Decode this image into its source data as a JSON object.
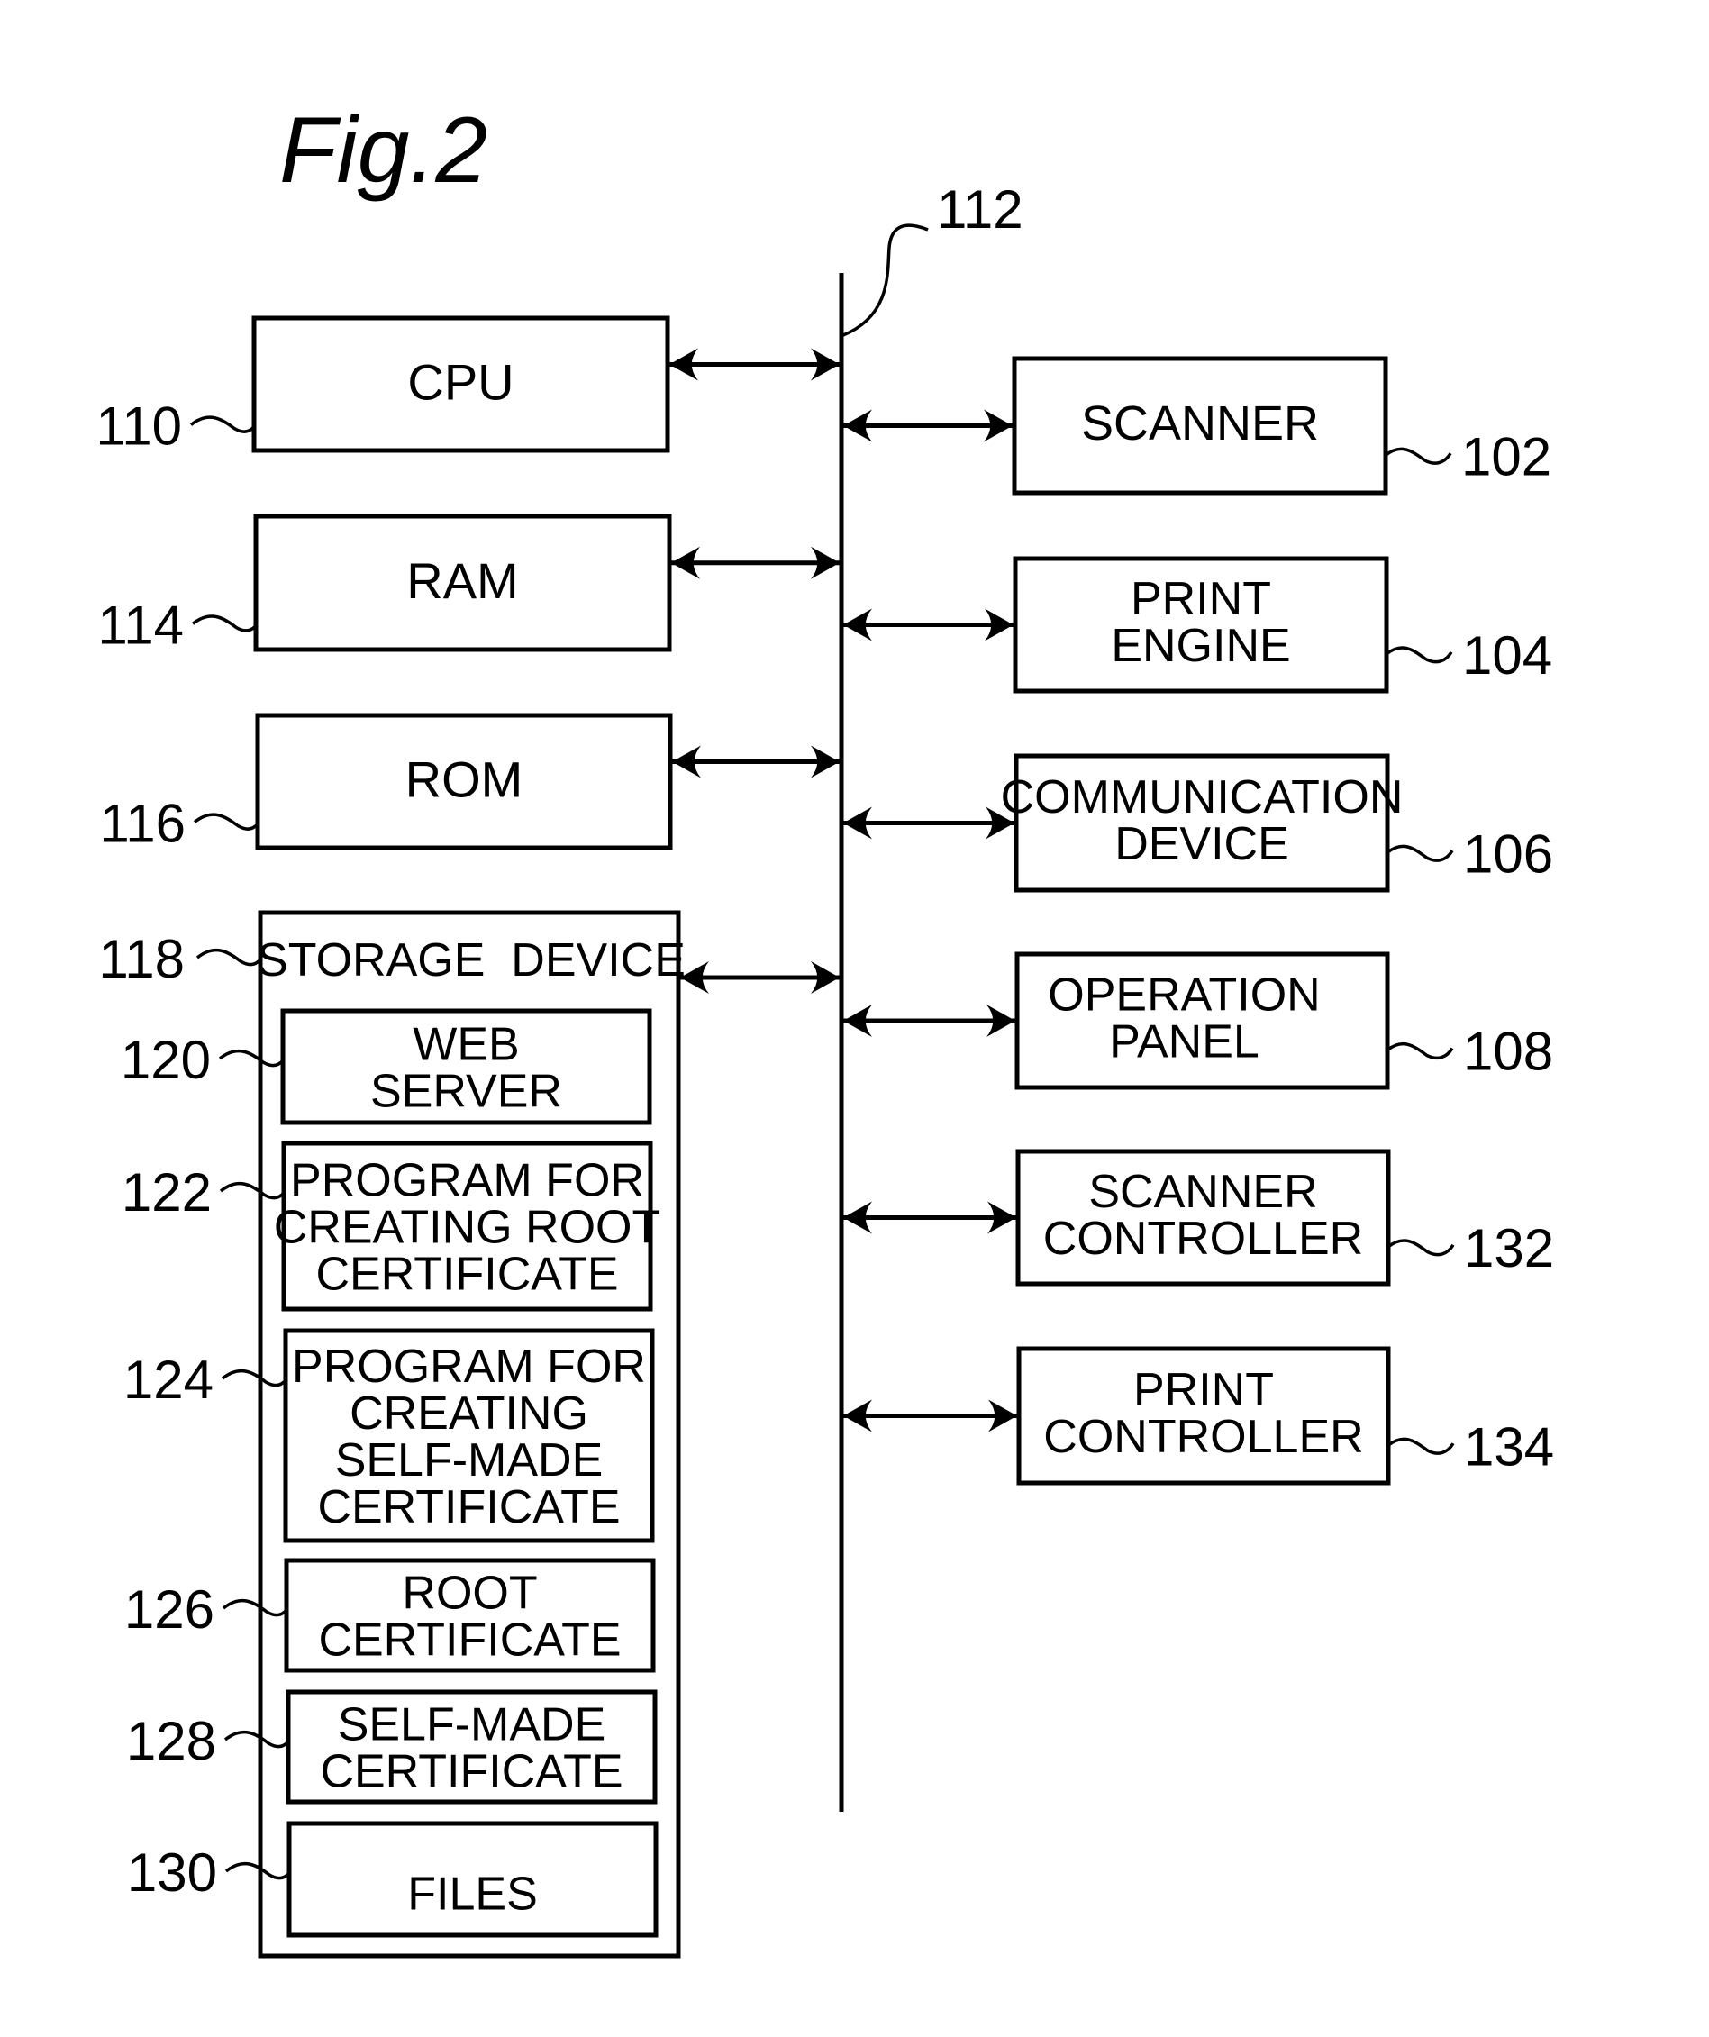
{
  "figure": {
    "title": "Fig.2",
    "bus": {
      "ref": "112"
    },
    "left_blocks": [
      {
        "id": "cpu",
        "ref": "110",
        "lines": [
          "CPU"
        ]
      },
      {
        "id": "ram",
        "ref": "114",
        "lines": [
          "RAM"
        ]
      },
      {
        "id": "rom",
        "ref": "116",
        "lines": [
          "ROM"
        ]
      }
    ],
    "storage": {
      "ref": "118",
      "label": "STORAGE  DEVICE",
      "items": [
        {
          "id": "web-server",
          "ref": "120",
          "lines": [
            "WEB",
            "SERVER"
          ]
        },
        {
          "id": "program-root-cert",
          "ref": "122",
          "lines": [
            "PROGRAM  FOR",
            "CREATING  ROOT",
            "CERTIFICATE"
          ]
        },
        {
          "id": "program-self-made-cert",
          "ref": "124",
          "lines": [
            "PROGRAM  FOR",
            "CREATING",
            "SELF-MADE",
            "CERTIFICATE"
          ]
        },
        {
          "id": "root-certificate",
          "ref": "126",
          "lines": [
            "ROOT",
            "CERTIFICATE"
          ]
        },
        {
          "id": "self-made-certificate",
          "ref": "128",
          "lines": [
            "SELF-MADE",
            "CERTIFICATE"
          ]
        },
        {
          "id": "files",
          "ref": "130",
          "lines": [
            "FILES"
          ]
        }
      ]
    },
    "right_blocks": [
      {
        "id": "scanner",
        "ref": "102",
        "lines": [
          "SCANNER"
        ]
      },
      {
        "id": "print-engine",
        "ref": "104",
        "lines": [
          "PRINT",
          "ENGINE"
        ]
      },
      {
        "id": "communication-device",
        "ref": "106",
        "lines": [
          "COMMUNICATION",
          "DEVICE"
        ]
      },
      {
        "id": "operation-panel",
        "ref": "108",
        "lines": [
          "OPERATION",
          "PANEL"
        ]
      },
      {
        "id": "scanner-controller",
        "ref": "132",
        "lines": [
          "SCANNER",
          "CONTROLLER"
        ]
      },
      {
        "id": "print-controller",
        "ref": "134",
        "lines": [
          "PRINT",
          "CONTROLLER"
        ]
      }
    ]
  }
}
